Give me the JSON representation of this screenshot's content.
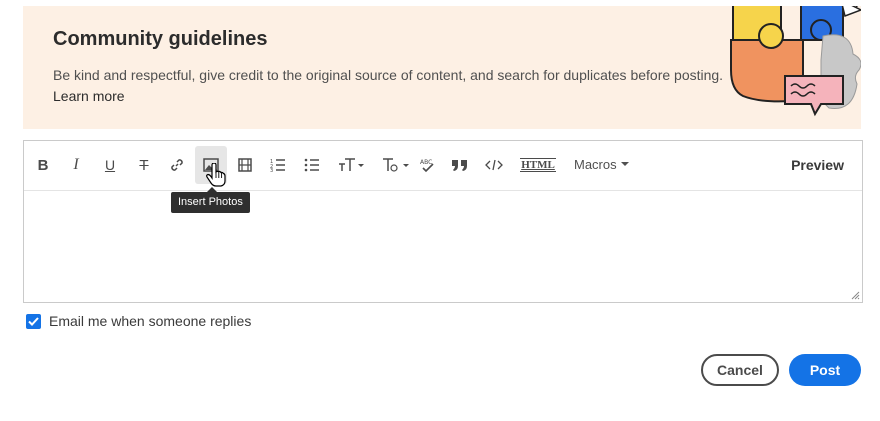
{
  "banner": {
    "title": "Community guidelines",
    "text": "Be kind and respectful, give credit to the original source of content, and search for duplicates before posting.",
    "link": "Learn more",
    "background_color": "#fdf0e4"
  },
  "toolbar": {
    "buttons": [
      {
        "name": "bold",
        "glyph": "B"
      },
      {
        "name": "italic",
        "glyph": "I"
      },
      {
        "name": "underline",
        "glyph": "U"
      },
      {
        "name": "strikethrough",
        "glyph": "T"
      },
      {
        "name": "insert-link",
        "glyph": ""
      },
      {
        "name": "insert-photos",
        "glyph": ""
      },
      {
        "name": "insert-video",
        "glyph": ""
      },
      {
        "name": "numbered-list",
        "glyph": ""
      },
      {
        "name": "bulleted-list",
        "glyph": ""
      },
      {
        "name": "font-size",
        "glyph": ""
      },
      {
        "name": "text-style",
        "glyph": ""
      },
      {
        "name": "spell-check",
        "glyph": ""
      },
      {
        "name": "blockquote",
        "glyph": ""
      },
      {
        "name": "code",
        "glyph": ""
      },
      {
        "name": "html",
        "glyph": "HTML"
      }
    ],
    "macros_label": "Macros",
    "preview_label": "Preview"
  },
  "tooltip": {
    "text": "Insert Photos"
  },
  "options": {
    "email_label": "Email me when someone replies",
    "email_checked": true
  },
  "actions": {
    "cancel_label": "Cancel",
    "post_label": "Post"
  },
  "colors": {
    "accent": "#1473e6",
    "text": "#2c2c2c"
  }
}
